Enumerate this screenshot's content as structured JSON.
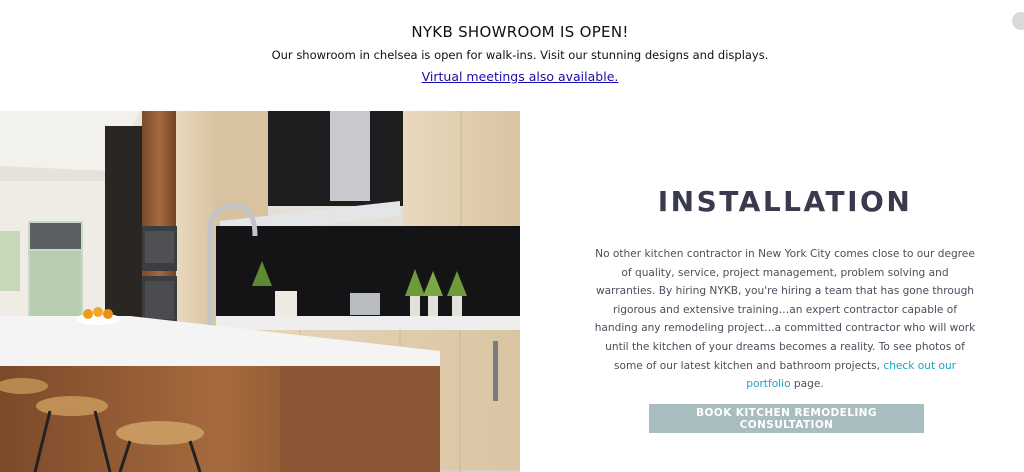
{
  "banner": {
    "title": "NYKB SHOWROOM IS OPEN!",
    "text": "Our showroom in chelsea is open for walk-ins. Visit our stunning designs and displays.",
    "link_label": "Virtual meetings also available."
  },
  "section": {
    "heading": "INSTALLATION",
    "body_text": "No other kitchen contractor in New York City comes close to our degree of quality, service, project management, problem solving and warranties.  By hiring NYKB, you're hiring a team that has gone through rigorous and extensive training…an expert contractor capable of handing any remodeling project…a committed contractor who will work until the kitchen of your dreams becomes a reality.  To see photos of some of our latest kitchen and bathroom projects, ",
    "portfolio_link": "check out our portfolio",
    "body_suffix": " page.",
    "cta_label": "BOOK KITCHEN REMODELING CONSULTATION"
  },
  "colors": {
    "heading": "#3a3a4e",
    "link": "#1a0dab",
    "portfolio_link": "#1aa4c4",
    "cta_background": "#a9bcc0"
  }
}
